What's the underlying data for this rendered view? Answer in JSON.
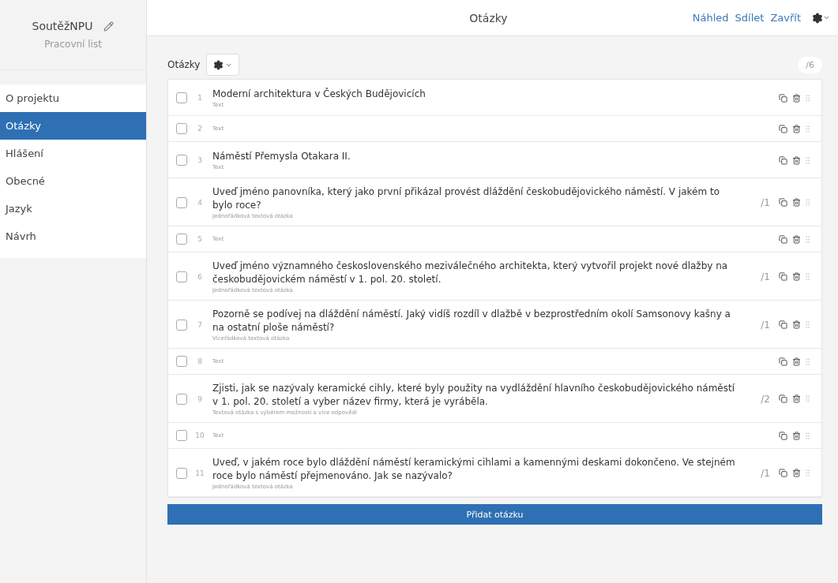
{
  "sidebar": {
    "project_name": "SoutěžNPU",
    "subtitle": "Pracovní list",
    "items": [
      {
        "label": "O projektu",
        "selected": false
      },
      {
        "label": "Otázky",
        "selected": true
      },
      {
        "label": "Hlášení",
        "selected": false
      },
      {
        "label": "Obecné",
        "selected": false
      },
      {
        "label": "Jazyk",
        "selected": false
      },
      {
        "label": "Návrh",
        "selected": false
      }
    ]
  },
  "header": {
    "title": "Otázky",
    "links": [
      "Náhled",
      "Sdílet",
      "Zavřít"
    ]
  },
  "questions_panel": {
    "label": "Otázky",
    "total_points": "/6",
    "add_button": "Přidat otázku",
    "rows": [
      {
        "number": "1",
        "title": "Moderní architektura v Českých Budějovicích",
        "type": "Text",
        "checked": false
      },
      {
        "number": "2",
        "type": "Text",
        "checked": false
      },
      {
        "number": "3",
        "title": "Náměstí Přemysla Otakara II.",
        "type": "Text",
        "checked": false
      },
      {
        "number": "4",
        "title": "Uveď jméno panovníka, který jako první přikázal provést dláždění českobudějovického náměstí. V jakém to bylo roce?",
        "type": "Jednořádková textová otázka",
        "points": "/1",
        "checked": false
      },
      {
        "number": "5",
        "type": "Text",
        "checked": false
      },
      {
        "number": "6",
        "title": "Uveď jméno významného československého meziválečného architekta, který vytvořil projekt nové dlažby na českobudějovickém náměstí v 1. pol. 20. století.",
        "type": "Jednořádková textová otázka",
        "points": "/1",
        "checked": false
      },
      {
        "number": "7",
        "title": "Pozorně se podívej na dláždění náměstí. Jaký vidíš rozdíl v dlažbě v bezprostředním okolí Samsonovy kašny a na ostatní ploše náměstí?",
        "type": "Víceřádková textová otázka",
        "points": "/1",
        "checked": false
      },
      {
        "number": "8",
        "type": "Text",
        "checked": false
      },
      {
        "number": "9",
        "title": "Zjisti, jak se nazývaly keramické cihly, které byly použity na vydláždění hlavního českobudějovického náměstí v 1. pol. 20. století a vyber název firmy, která je vyráběla.",
        "type": "Textová otázka s výběrem možností a více odpovědí",
        "points": "/2",
        "checked": false
      },
      {
        "number": "10",
        "type": "Text",
        "checked": false
      },
      {
        "number": "11",
        "title": "Uveď, v jakém roce bylo dláždění náměstí keramickými cihlami a kamennými deskami dokončeno. Ve stejném roce bylo náměstí přejmenováno. Jak se nazývalo?",
        "type": "Jednořádková textová otázka",
        "points": "/1",
        "checked": false
      }
    ]
  }
}
